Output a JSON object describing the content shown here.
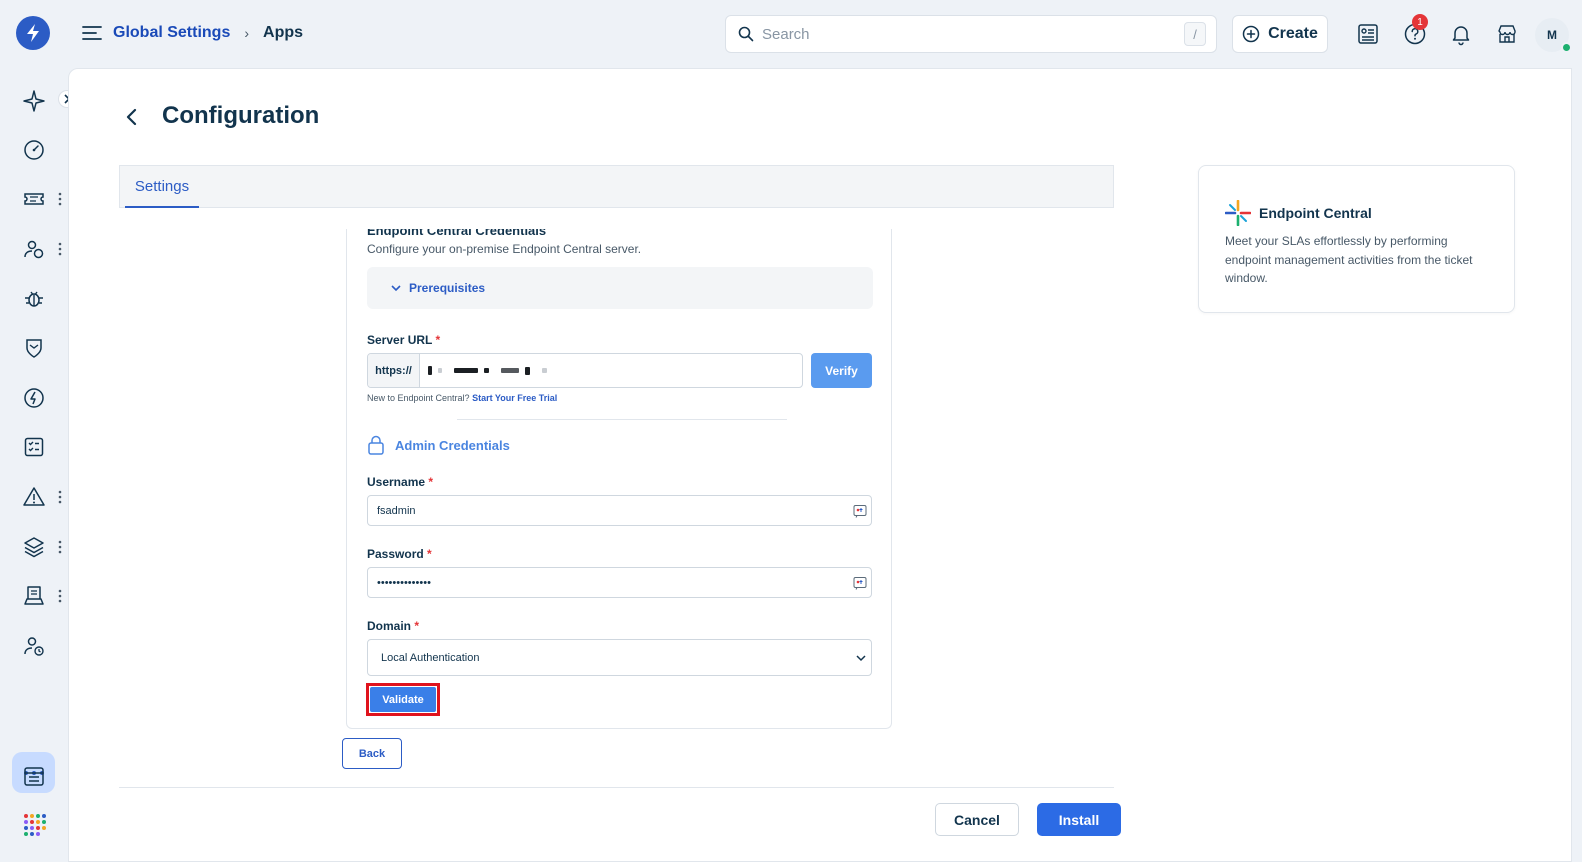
{
  "header": {
    "breadcrumb": {
      "parent": "Global Settings",
      "current": "Apps"
    },
    "search": {
      "placeholder": "Search",
      "shortcut": "/"
    },
    "create_label": "Create",
    "help_badge": "1",
    "avatar_initial": "M"
  },
  "sidebar": {
    "icons": [
      "sparkle-icon",
      "dashboard-icon",
      "ticket-icon",
      "contacts-icon",
      "bug-icon",
      "shield-icon",
      "change-icon",
      "tasks-icon",
      "alert-icon",
      "layers-icon",
      "assets-icon",
      "user-clock-icon",
      "more-icon",
      "calendar-icon",
      "apps-grid-icon"
    ]
  },
  "page": {
    "title": "Configuration",
    "tabs": [
      {
        "label": "Settings",
        "active": true
      }
    ]
  },
  "form": {
    "section_title": "Endpoint Central Credentials",
    "section_desc": "Configure your on-premise Endpoint Central server.",
    "prerequisites_label": "Prerequisites",
    "server_url": {
      "label": "Server URL",
      "required": "*",
      "prefix": "https://",
      "verify_label": "Verify"
    },
    "trial": {
      "text": "New to Endpoint Central?",
      "link": "Start Your Free Trial"
    },
    "admin_heading": "Admin Credentials",
    "username": {
      "label": "Username",
      "required": "*",
      "value": "fsadmin"
    },
    "password": {
      "label": "Password",
      "required": "*",
      "value": "••••••••••••••"
    },
    "domain": {
      "label": "Domain",
      "required": "*",
      "value": "Local Authentication"
    },
    "validate_label": "Validate",
    "back_label": "Back"
  },
  "footer": {
    "cancel_label": "Cancel",
    "install_label": "Install"
  },
  "info_card": {
    "title": "Endpoint Central",
    "description": "Meet your SLAs effortlessly by performing endpoint management activities from the ticket window."
  },
  "colors": {
    "accent": "#2c5cc5",
    "primary_button": "#2c6be5",
    "highlight": "#e0131d",
    "badge": "#e43538"
  }
}
